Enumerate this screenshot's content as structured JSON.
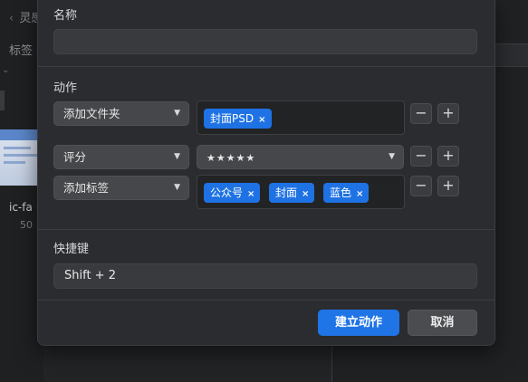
{
  "background": {
    "crumb": "灵感",
    "tag_title": "标签",
    "file_name": "ic-fa",
    "file_size": "50"
  },
  "dialog": {
    "name_label": "名称",
    "name_value": "",
    "actions_label": "动作",
    "actions": [
      {
        "type": "添加文件夹",
        "tokens": [
          "封面PSD"
        ]
      },
      {
        "type": "评分",
        "value": "★★★★★"
      },
      {
        "type": "添加标签",
        "tokens": [
          "公众号",
          "封面",
          "蓝色"
        ]
      }
    ],
    "remove_symbol": "−",
    "add_symbol": "+",
    "token_remove_symbol": "×",
    "shortcut_label": "快捷键",
    "shortcut_value": "Shift + 2",
    "create_button": "建立动作",
    "cancel_button": "取消"
  },
  "colors": {
    "accent": "#1f74e6",
    "dialog_bg": "#2b2c2f"
  }
}
